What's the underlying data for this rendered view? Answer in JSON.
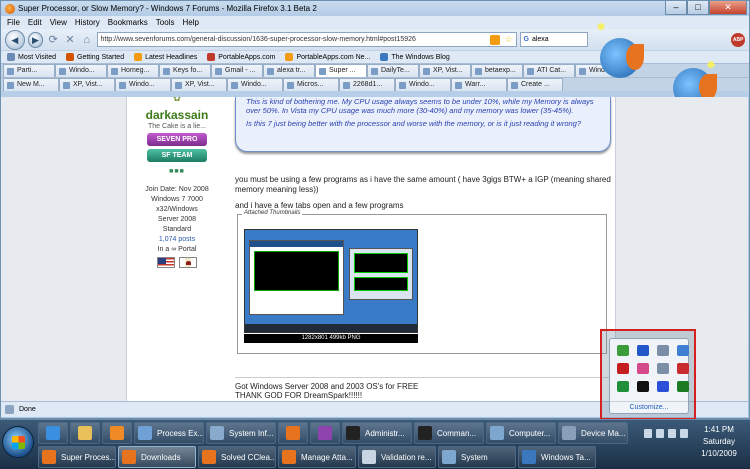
{
  "window": {
    "title": "Super Processor, or Slow Memory? - Windows 7 Forums - Mozilla Firefox 3.1 Beta 2",
    "controls": [
      "–",
      "□",
      "✕"
    ]
  },
  "menu": [
    "File",
    "Edit",
    "View",
    "History",
    "Bookmarks",
    "Tools",
    "Help"
  ],
  "nav": {
    "url": "http://www.sevenforums.com/general-discussion/1636-super-processor-slow-memory.html#post15926",
    "search_value": "alexa",
    "abp_label": "ABP"
  },
  "bookmarks": [
    "Most Visited",
    "Getting Started",
    "Latest Headlines",
    "PortableApps.com",
    "PortableApps.com Ne...",
    "The Windows Blog"
  ],
  "tabs_row1": [
    {
      "label": "Parti..."
    },
    {
      "label": "Windo..."
    },
    {
      "label": "Homeg..."
    },
    {
      "label": "Keys fo..."
    },
    {
      "label": "Gmail - ..."
    },
    {
      "label": "alexa tr..."
    },
    {
      "label": "Super ...",
      "active": true
    },
    {
      "label": "DailyTe..."
    },
    {
      "label": "XP, Vist..."
    },
    {
      "label": "betaexp..."
    },
    {
      "label": "ATI Cat..."
    },
    {
      "label": "Windo..."
    }
  ],
  "tabs_row2": [
    {
      "label": "New M..."
    },
    {
      "label": "XP, Vist..."
    },
    {
      "label": "Windo..."
    },
    {
      "label": "XP, Vist..."
    },
    {
      "label": "Windo..."
    },
    {
      "label": "Micros..."
    },
    {
      "label": "2268d1..."
    },
    {
      "label": "Windo..."
    },
    {
      "label": "Warr..."
    },
    {
      "label": "Create ..."
    }
  ],
  "sidebar": {
    "username": "darkassain",
    "user_title": "The Cake is a lie...",
    "rank1": "SEVEN PRO",
    "rank2": "SF TEAM",
    "join_date": "Join Date: Nov 2008",
    "os_line1": "Windows 7 7000",
    "os_line2": "x32/Windows",
    "os_line3": "Server 2008",
    "os_line4": "Standard",
    "posts": "1,074 posts",
    "location": "In a ∞ Portal"
  },
  "quote": {
    "p1": "This is kind of bothering me. My CPU usage always seems to be under 10%, while my Memory is always over 50%. In Vista my CPU usage was much more (30-40%) and my memory was lower (35-45%).",
    "p2": "Is this 7 just being better with the processor and worse with the memory, or is it just reading it wrong?"
  },
  "post": {
    "line1": "you must be using a few programs as i have the same amount ( have 3gigs BTW+ a IGP (meaning shared memory meaning less))",
    "line2": "and i have a few tabs open and a few programs",
    "attach_legend": "Attached Thumbnails",
    "thumb_caption": "1282x801  499kb PNG"
  },
  "post2": {
    "line1": "Got Windows Server 2008 and 2003 OS's for FREE",
    "line2": "THANK GOD FOR DreamSpark!!!!!!"
  },
  "overflow": {
    "customize": "Customize...",
    "icon_colors": [
      "#3a9d3a",
      "#2257c9",
      "#7a8ea8",
      "#3d7fd1",
      "#c41e1e",
      "#d44a8a",
      "#7b8fa6",
      "#c92c2c",
      "#1f8f3a",
      "#111111",
      "#2b4fd6",
      "#1c7a22"
    ]
  },
  "status": {
    "text": "Done"
  },
  "taskbar": {
    "row1": [
      {
        "label": "",
        "icon": "ie-icon",
        "color": "#3b8fe0"
      },
      {
        "label": "",
        "icon": "folder-icon",
        "color": "#e8c15a"
      },
      {
        "label": "",
        "icon": "media-player-icon",
        "color": "#f08a24"
      },
      {
        "label": "Process Ex...",
        "icon": "process-explorer-icon",
        "color": "#6fa0d6"
      },
      {
        "label": "System Inf...",
        "icon": "system-info-icon",
        "color": "#88aacc"
      },
      {
        "label": "",
        "icon": "firefox-icon",
        "color": "#e8731e"
      },
      {
        "label": "",
        "icon": "onenote-icon",
        "color": "#8e44ad"
      },
      {
        "label": "Administr...",
        "icon": "cmd-icon",
        "color": "#222222"
      },
      {
        "label": "Comman...",
        "icon": "cmd-icon",
        "color": "#222222"
      },
      {
        "label": "Computer...",
        "icon": "computer-icon",
        "color": "#7ea7cf"
      },
      {
        "label": "Device Ma...",
        "icon": "device-manager-icon",
        "color": "#8aa0b8"
      }
    ],
    "row2": [
      {
        "label": "Super Proces...",
        "icon": "firefox-icon",
        "color": "#e8731e"
      },
      {
        "label": "Downloads",
        "icon": "firefox-icon",
        "color": "#e8731e",
        "active": true
      },
      {
        "label": "Solved CClea...",
        "icon": "firefox-icon",
        "color": "#e8731e"
      },
      {
        "label": "Manage Atta...",
        "icon": "firefox-icon",
        "color": "#e8731e"
      },
      {
        "label": "Validation re...",
        "icon": "document-icon",
        "color": "#c8d6e4"
      },
      {
        "label": "System",
        "icon": "system-icon",
        "color": "#7ea7cf"
      },
      {
        "label": "Windows Ta...",
        "icon": "windows-icon",
        "color": "#3a78c0"
      }
    ],
    "clock": {
      "time": "1:41 PM",
      "day": "Saturday",
      "date": "1/10/2009"
    }
  }
}
